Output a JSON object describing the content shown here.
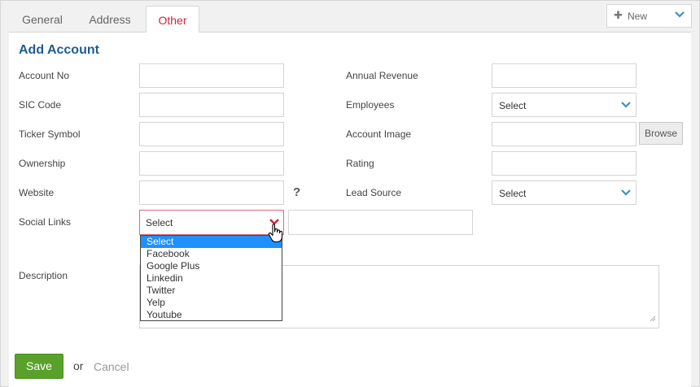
{
  "tabs": [
    {
      "label": "General"
    },
    {
      "label": "Address"
    },
    {
      "label": "Other",
      "active": true
    }
  ],
  "new_button": {
    "label": "New",
    "icon": "plus-icon"
  },
  "form": {
    "title": "Add Account",
    "left": {
      "account_no": "Account No",
      "sic_code": "SIC Code",
      "ticker_symbol": "Ticker Symbol",
      "ownership": "Ownership",
      "website": "Website",
      "social_links": "Social Links",
      "description": "Description"
    },
    "right": {
      "annual_revenue": "Annual Revenue",
      "employees": "Employees",
      "account_image": "Account Image",
      "rating": "Rating",
      "lead_source": "Lead Source"
    },
    "employees_value": "Select",
    "lead_source_value": "Select",
    "browse_label": "Browse",
    "help_glyph": "?",
    "social_value": "Select",
    "social_options": [
      "Select",
      "Facebook",
      "Google Plus",
      "Linkedin",
      "Twitter",
      "Yelp",
      "Youtube"
    ]
  },
  "footer": {
    "save": "Save",
    "or": "or",
    "cancel": "Cancel"
  },
  "colors": {
    "accent_title": "#1d5c92",
    "active_tab": "#d0223c",
    "save_green": "#5aa12c",
    "option_highlight": "#1e90ff",
    "chevron_blue": "#3c8fc7",
    "chevron_red": "#d0223c"
  }
}
